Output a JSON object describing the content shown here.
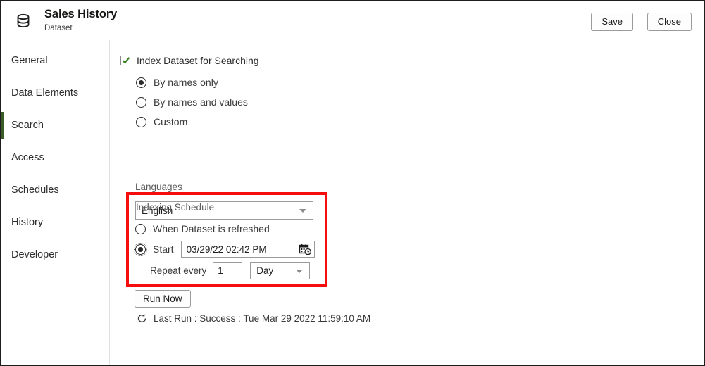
{
  "header": {
    "icon": "database-icon",
    "title": "Sales History",
    "subtitle": "Dataset",
    "save_label": "Save",
    "close_label": "Close"
  },
  "sidebar": {
    "items": [
      {
        "label": "General",
        "selected": false
      },
      {
        "label": "Data Elements",
        "selected": false
      },
      {
        "label": "Search",
        "selected": true
      },
      {
        "label": "Access",
        "selected": false
      },
      {
        "label": "Schedules",
        "selected": false
      },
      {
        "label": "History",
        "selected": false
      },
      {
        "label": "Developer",
        "selected": false
      }
    ],
    "accent_color": "#3c5a28"
  },
  "main": {
    "index_checkbox": {
      "label": "Index Dataset for Searching",
      "checked": true,
      "check_color": "#3a7d22"
    },
    "index_mode": {
      "options": [
        {
          "label": "By names only",
          "selected": true
        },
        {
          "label": "By names and values",
          "selected": false
        },
        {
          "label": "Custom",
          "selected": false
        }
      ]
    },
    "languages": {
      "label": "Languages",
      "value": "English"
    },
    "indexing_schedule": {
      "label": "Indexing Schedule",
      "highlight_color": "#f60d0d",
      "options": [
        {
          "label": "When Dataset is refreshed",
          "selected": false
        },
        {
          "label": "Start",
          "selected": true
        }
      ],
      "start_date": "03/29/22 02:42 PM",
      "calendar_icon": "calendar-clock-icon",
      "repeat_label": "Repeat every",
      "repeat_value": "1",
      "repeat_unit": "Day"
    },
    "run_now_label": "Run Now",
    "last_run": {
      "icon": "refresh-icon",
      "text": "Last Run : Success : Tue Mar 29 2022 11:59:10 AM"
    }
  }
}
